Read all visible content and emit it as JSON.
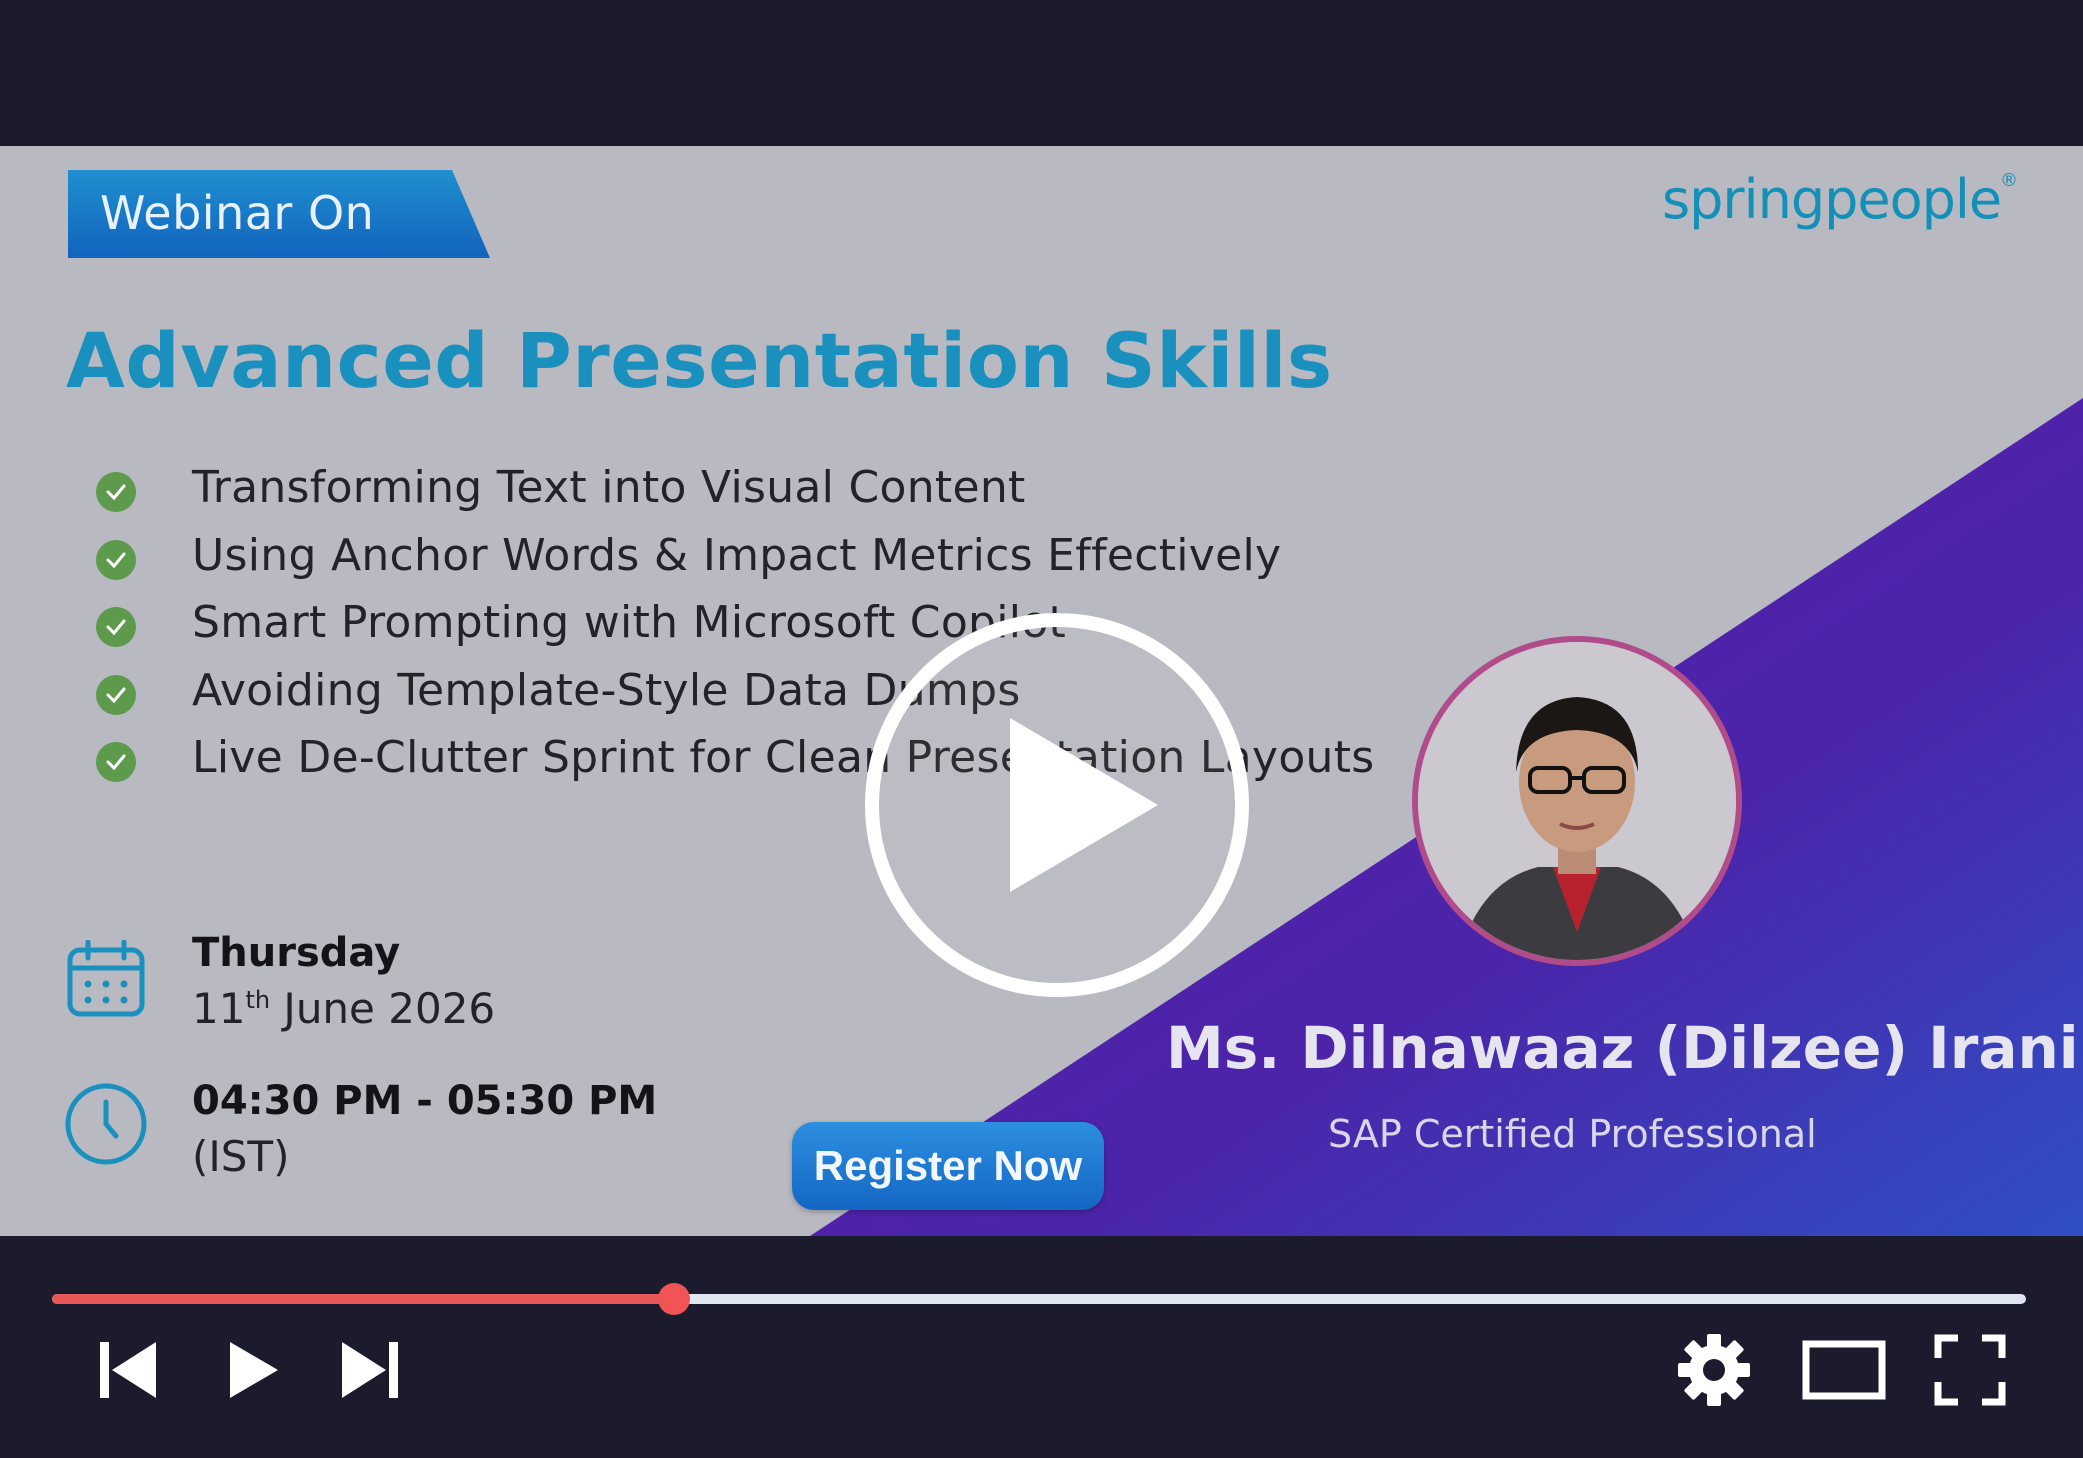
{
  "slide": {
    "tag": "Webinar On",
    "logo": "springpeople",
    "title": "Advanced Presentation Skills",
    "bullets": [
      "Transforming Text into Visual Content",
      "Using Anchor Words & Impact Metrics Effectively",
      "Smart Prompting with Microsoft Copilot",
      "Avoiding Template-Style Data Dumps",
      "Live De-Clutter Sprint for Clean Presentation Layouts"
    ],
    "day": "Thursday",
    "date_day": "11",
    "date_suffix": "th",
    "date_rest": " June 2026",
    "time": "04:30 PM - 05:30 PM",
    "timezone": "(IST)",
    "register_label": "Register Now",
    "speaker_name": "Ms. Dilnawaaz (Dilzee) Irani",
    "speaker_role": "SAP Certified Professional"
  },
  "player": {
    "progress": 0.315,
    "icons": [
      "play-icon",
      "previous-icon",
      "next-icon",
      "settings-icon",
      "theater-mode-icon",
      "fullscreen-icon"
    ]
  },
  "colors": {
    "background": "#1c1b2e",
    "slide": "#b9b9c1",
    "accent_blue": "#1990be",
    "purple": "#4a22a8",
    "progress": "#e85757"
  }
}
